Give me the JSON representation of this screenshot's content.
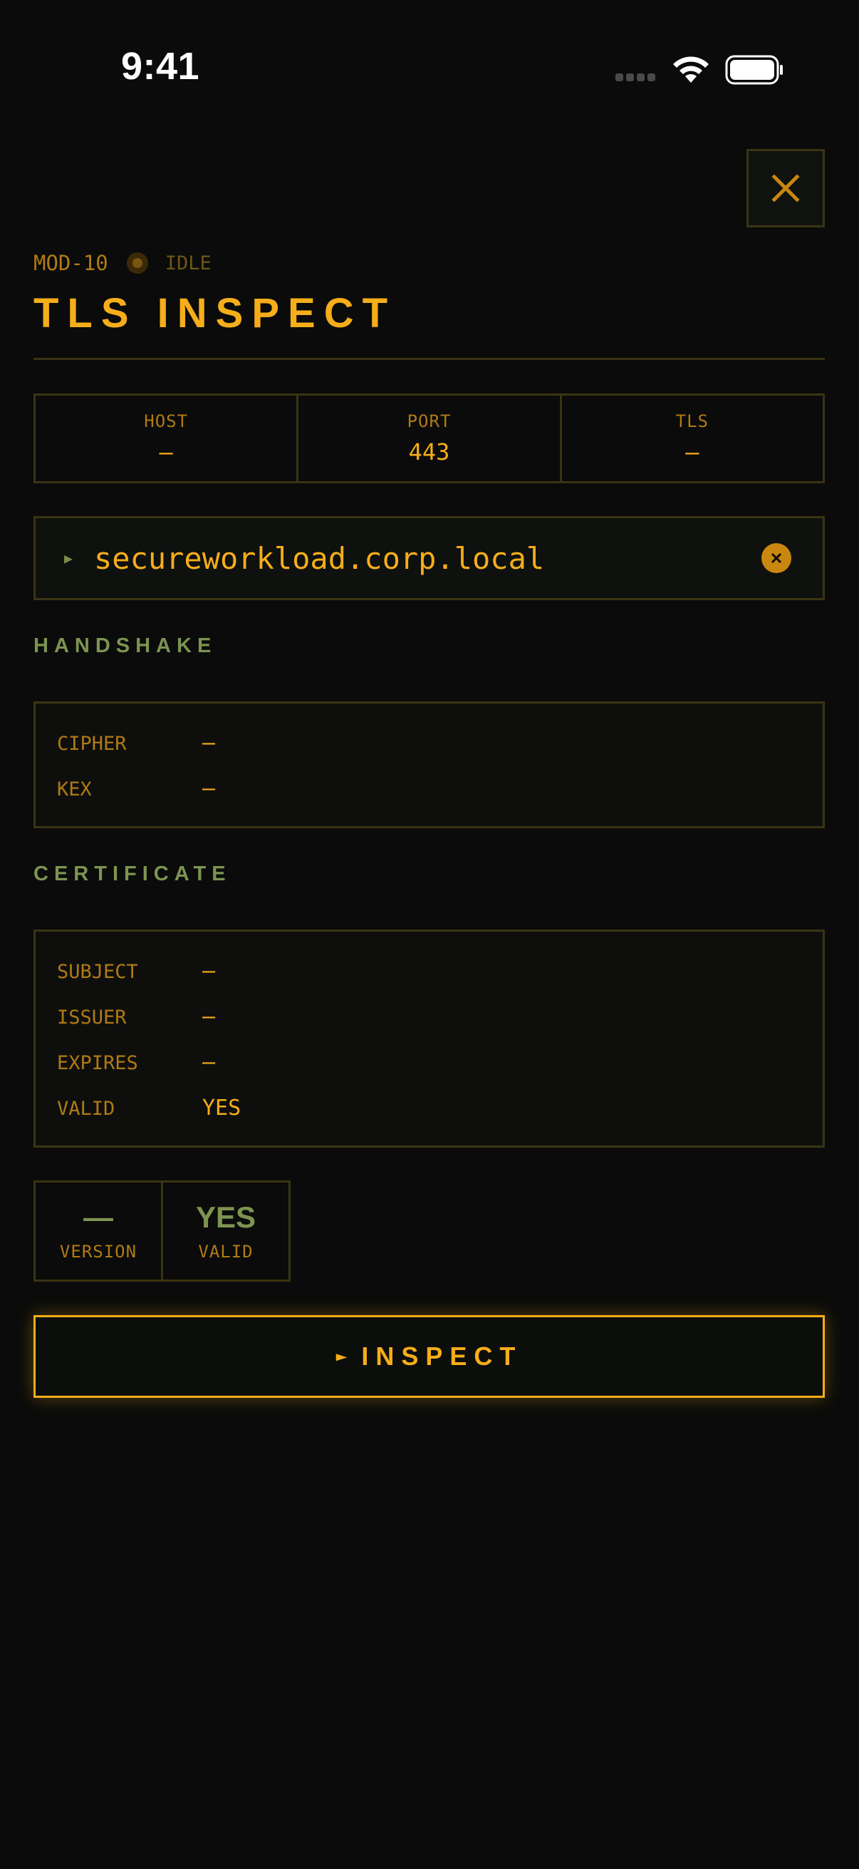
{
  "status_bar": {
    "time": "9:41",
    "icons": [
      "cellular-signal-icon",
      "wifi-icon",
      "battery-icon"
    ]
  },
  "header": {
    "module_id": "MOD-10",
    "status": "IDLE",
    "title": "TLS INSPECT",
    "close_icon": "close-icon"
  },
  "stats": [
    {
      "label": "HOST",
      "value": "—"
    },
    {
      "label": "PORT",
      "value": "443"
    },
    {
      "label": "TLS",
      "value": "—"
    }
  ],
  "host_input": {
    "value": "secureworkload.corp.local",
    "prompt_icon": "play-icon",
    "clear_icon": "clear-icon"
  },
  "handshake": {
    "heading": "HANDSHAKE",
    "rows": [
      {
        "key": "CIPHER",
        "value": "—"
      },
      {
        "key": "KEX",
        "value": "—"
      }
    ]
  },
  "certificate": {
    "heading": "CERTIFICATE",
    "rows": [
      {
        "key": "SUBJECT",
        "value": "—"
      },
      {
        "key": "ISSUER",
        "value": "—"
      },
      {
        "key": "EXPIRES",
        "value": "—"
      },
      {
        "key": "VALID",
        "value": "YES"
      }
    ]
  },
  "summary_tiles": [
    {
      "value": "—",
      "label": "VERSION"
    },
    {
      "value": "YES",
      "label": "VALID"
    }
  ],
  "inspect_button": {
    "label": "INSPECT",
    "arrow": "►"
  },
  "colors": {
    "background": "#0a0b0a",
    "accent": "#f5ad1a",
    "muted_accent": "#b07a14",
    "section_green": "#7d9451",
    "border": "#3a3414"
  }
}
